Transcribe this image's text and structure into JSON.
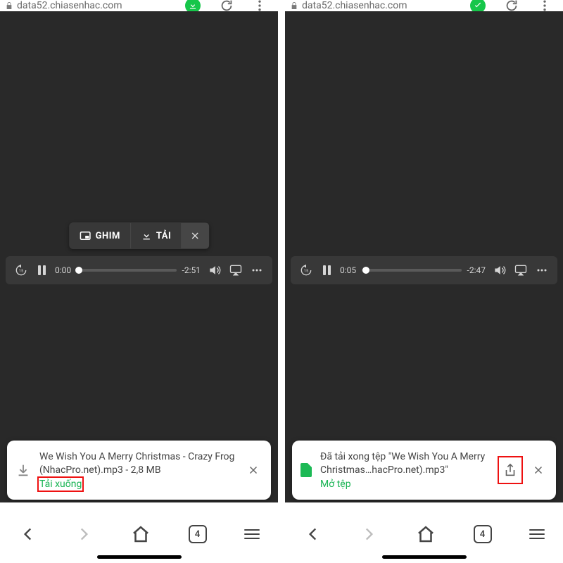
{
  "address_url": "data52.chiasenhac.com",
  "left": {
    "pill": {
      "ghim": "GHIM",
      "tai": "TẢI"
    },
    "player": {
      "current": "0:00",
      "remaining": "-2:51",
      "progress_pct": 2
    },
    "download": {
      "title": "We Wish You A Merry Christmas - Crazy Frog (NhacPro.net).mp3 - 2,8 MB",
      "action": "Tải xuống"
    }
  },
  "right": {
    "player": {
      "current": "0:05",
      "remaining": "-2:47",
      "progress_pct": 4
    },
    "download": {
      "title": "Đã tải xong tệp \"We Wish You A Merry Christmas…hacPro.net).mp3\"",
      "action": "Mở tệp"
    }
  },
  "nav": {
    "tab_count": "4"
  }
}
